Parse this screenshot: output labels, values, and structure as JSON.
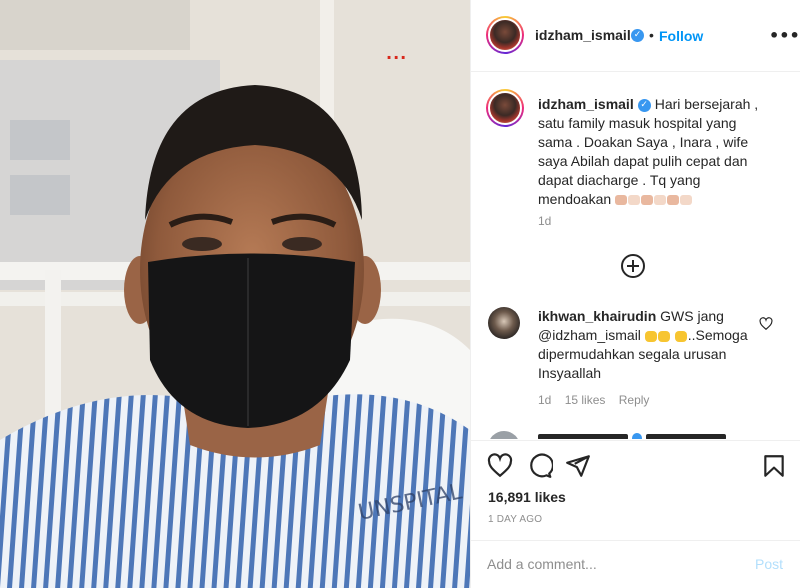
{
  "post": {
    "photo_alt": "selfie photo",
    "photo_overlay_text": "...",
    "author": {
      "username": "idzham_ismail",
      "verified_icon": "verified-badge-icon",
      "separator": "•",
      "follow_label": "Follow",
      "more_label": "•••"
    },
    "caption": {
      "username": "idzham_ismail",
      "text": "Hari bersejarah , satu family masuk hospital yang sama . Doakan Saya , Inara , wife saya Abilah dapat pulih cepat dan dapat diacharge . Tq yang mendoakan",
      "emoji": [
        "muscle",
        "skin",
        "muscle",
        "skin",
        "muscle",
        "skin"
      ],
      "time": "1d"
    },
    "load_more_icon": "plus-circle-icon",
    "comments": [
      {
        "username": "ikhwan_khairudin",
        "text_part1": "GWS jang",
        "mention": "@idzham_ismail",
        "text_part2": "..Semoga dipermudahkan segala urusan Insyaallah",
        "time": "1d",
        "likes": "15 likes",
        "reply_label": "Reply"
      }
    ],
    "actions": {
      "like_icon": "heart-icon",
      "comment_icon": "comment-icon",
      "share_icon": "share-icon",
      "save_icon": "bookmark-icon"
    },
    "likes": "16,891 likes",
    "posted_ago": "1 DAY AGO",
    "add_comment": {
      "placeholder": "Add a comment...",
      "post_label": "Post"
    },
    "colors": {
      "accent": "#0095f6",
      "verified": "#3897f0",
      "post_disabled": "#b2dffc",
      "muted": "#8e8e8e",
      "text": "#262626"
    }
  }
}
